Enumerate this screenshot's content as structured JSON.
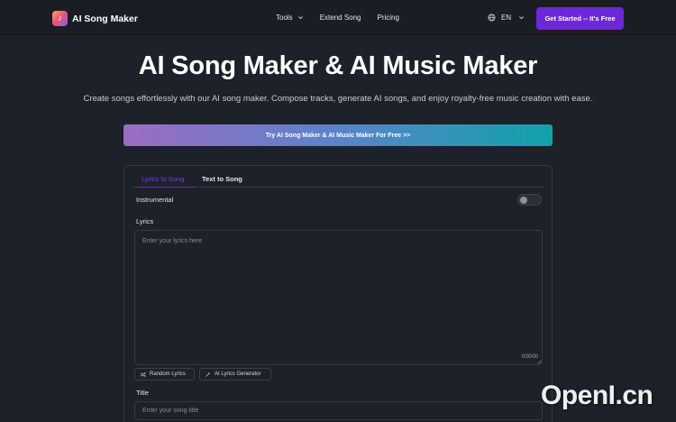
{
  "brand": {
    "name": "AI Song Maker",
    "logo_icon": "music-note-icon"
  },
  "nav": {
    "links": [
      {
        "label": "Tools",
        "has_dropdown": true
      },
      {
        "label": "Extend Song",
        "has_dropdown": false
      },
      {
        "label": "Pricing",
        "has_dropdown": false
      }
    ],
    "language": "EN",
    "cta_label": "Get Started -- It's Free"
  },
  "hero": {
    "title": "AI Song Maker & AI Music Maker",
    "subtitle": "Create songs effortlessly with our AI song maker. Compose tracks, generate AI songs, and enjoy royalty-free music creation with ease.",
    "banner_label": "Try AI Song Maker & AI Music Maker For Free >>"
  },
  "form": {
    "tabs": [
      {
        "label": "Lyrics to Song",
        "active": true
      },
      {
        "label": "Text to Song",
        "active": false
      }
    ],
    "instrumental_label": "Instrumental",
    "instrumental_on": false,
    "lyrics_label": "Lyrics",
    "lyrics_placeholder": "Enter your lyrics here",
    "lyrics_counter": "0/3000",
    "random_lyrics_label": "Random Lyrics",
    "ai_lyrics_label": "AI Lyrics Generator",
    "title_label": "Title",
    "title_placeholder": "Enter your song title"
  },
  "watermark": "OpenI.cn",
  "colors": {
    "background": "#1d2129",
    "accent": "#6d28d9",
    "banner_start": "#9b6cc4",
    "banner_end": "#0fa3a9"
  }
}
